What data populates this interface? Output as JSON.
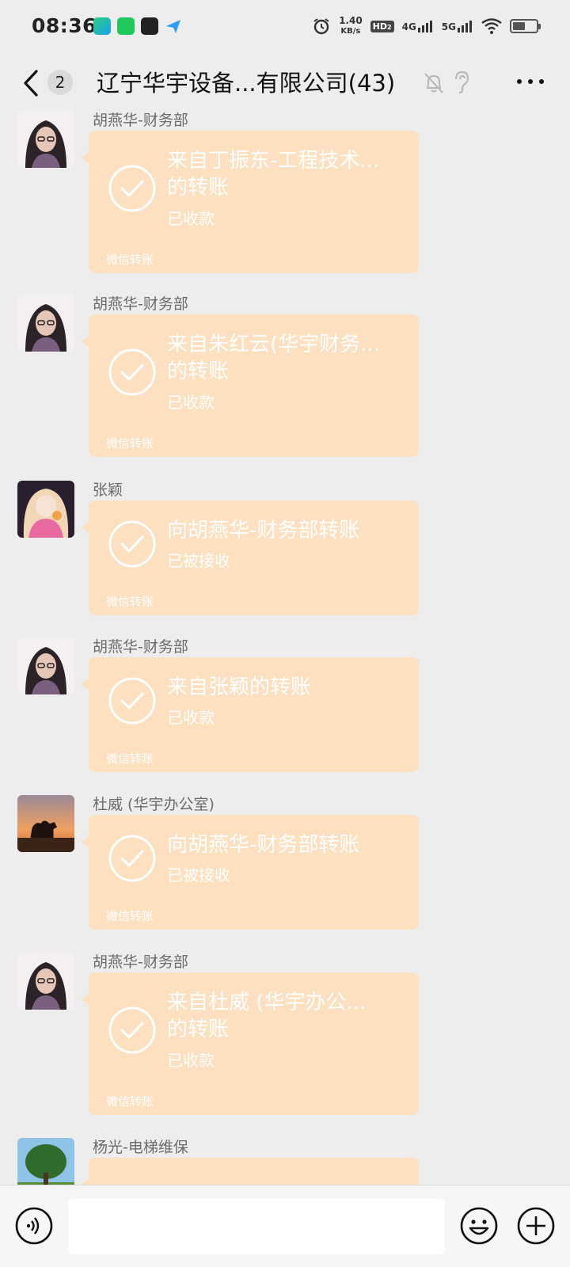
{
  "status_bar": {
    "time": "08:36",
    "net_speed_value": "1.40",
    "net_speed_unit": "KB/s",
    "hd": "HD",
    "hd_sub": "2",
    "sig1": "4G",
    "sig2": "5G",
    "battery_level": 0.55
  },
  "nav": {
    "unread_count": "2",
    "title": "辽宁华宇设备...有限公司(43)"
  },
  "messages": [
    {
      "sender": "胡燕华-财务部",
      "avatar": "woman-glasses-avatar",
      "title_line1": "来自丁振东-工程技术...",
      "title_line2": "的转账",
      "status": "已收款",
      "footer": "微信转账"
    },
    {
      "sender": "胡燕华-财务部",
      "avatar": "woman-glasses-avatar",
      "title_line1": "来自朱红云(华宇财务...",
      "title_line2": "的转账",
      "status": "已收款",
      "footer": "微信转账"
    },
    {
      "sender": "张颖",
      "avatar": "anime-girl-avatar",
      "title_line1": "向胡燕华-财务部转账",
      "title_line2": "",
      "status": "已被接收",
      "footer": "微信转账"
    },
    {
      "sender": "胡燕华-财务部",
      "avatar": "woman-glasses-avatar",
      "title_line1": "来自张颖的转账",
      "title_line2": "",
      "status": "已收款",
      "footer": "微信转账"
    },
    {
      "sender": "杜威 (华宇办公室)",
      "avatar": "desert-camel-avatar",
      "title_line1": "向胡燕华-财务部转账",
      "title_line2": "",
      "status": "已被接收",
      "footer": "微信转账"
    },
    {
      "sender": "胡燕华-财务部",
      "avatar": "woman-glasses-avatar",
      "title_line1": "来自杜威 (华宇办公...",
      "title_line2": "的转账",
      "status": "已收款",
      "footer": "微信转账"
    },
    {
      "sender": "杨光-电梯维保",
      "avatar": "tree-avatar"
    }
  ],
  "input": {
    "value": ""
  },
  "colors": {
    "bubble": "#fde0c0",
    "background": "#ededed"
  }
}
